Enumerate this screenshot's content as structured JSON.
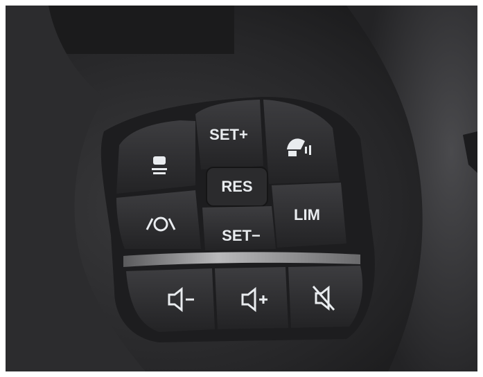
{
  "scene": {
    "subject": "steering-wheel-control-pad",
    "colors": {
      "background": "#ffffff",
      "leather": "#2a2a2c",
      "button": "#2f2f31",
      "label": "#e9ecef",
      "chrome_strip": "#8a8c8f"
    }
  },
  "buttons": {
    "set_plus": {
      "label": "SET+",
      "icon": null
    },
    "res": {
      "label": "RES",
      "icon": null
    },
    "set_minus": {
      "label": "SET−",
      "icon": null
    },
    "lim": {
      "label": "LIM",
      "icon": null
    },
    "lane_keep": {
      "label": null,
      "icon": "lane-keeping-icon"
    },
    "cruise_toggle": {
      "label": null,
      "icon": "cruise-control-icon"
    },
    "adaptive_cruise": {
      "label": null,
      "icon": "adaptive-cruise-gauge-icon"
    },
    "volume_down": {
      "label": null,
      "icon": "volume-down-icon"
    },
    "volume_up": {
      "label": null,
      "icon": "volume-up-icon"
    },
    "mute": {
      "label": null,
      "icon": "mute-icon"
    }
  }
}
